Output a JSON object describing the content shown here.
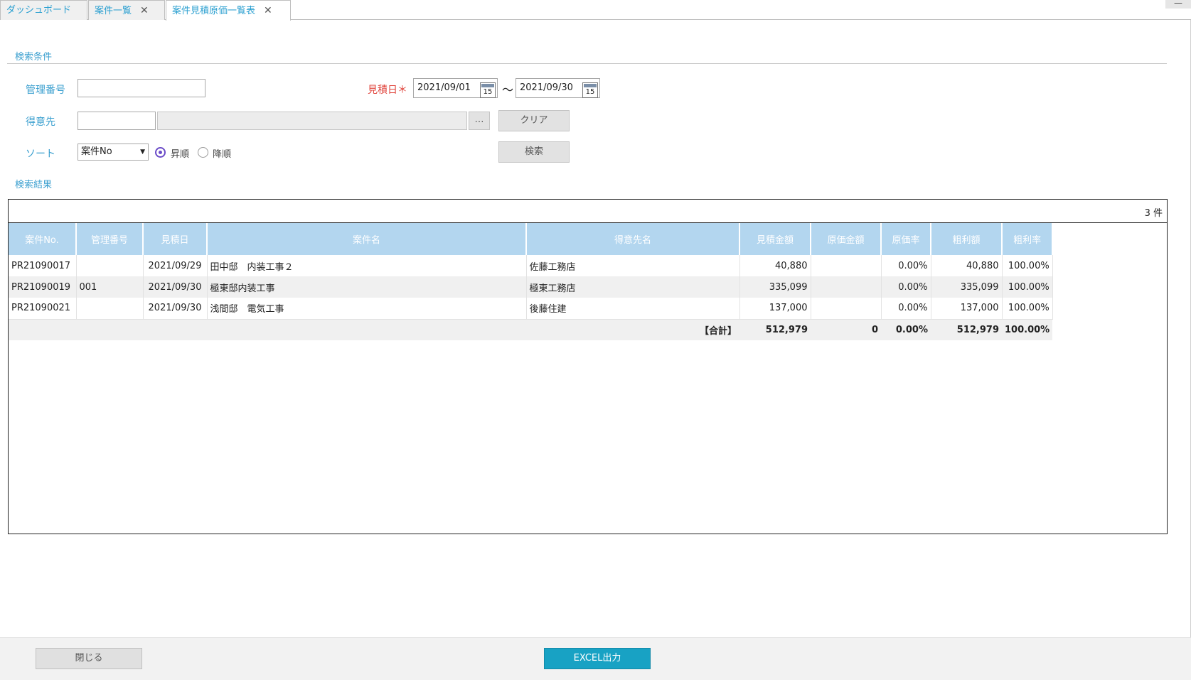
{
  "tabs": [
    {
      "label": "ダッシュボード",
      "closable": false
    },
    {
      "label": "案件一覧",
      "closable": true
    },
    {
      "label": "案件見積原価一覧表",
      "closable": true,
      "active": true
    }
  ],
  "window": {
    "minimize_label": "—"
  },
  "search": {
    "section_title": "検索条件",
    "mgmt_no_label": "管理番号",
    "mgmt_no_value": "",
    "estimate_date_label": "見積日＊",
    "date_from": "2021/09/01",
    "date_to": "2021/09/30",
    "date_sep": "〜",
    "calendar_icon_text": "15",
    "customer_label": "得意先",
    "customer_code": "",
    "customer_name": "",
    "lookup_label": "…",
    "clear_label": "クリア",
    "sort_label": "ソート",
    "sort_value": "案件No",
    "sort_asc_label": "昇順",
    "sort_desc_label": "降順",
    "sort_order": "asc",
    "search_label": "検索"
  },
  "results": {
    "section_title": "検索結果",
    "count_text": "3 件",
    "columns": [
      "案件No.",
      "管理番号",
      "見積日",
      "案件名",
      "得意先名",
      "見積金額",
      "原価金額",
      "原価率",
      "粗利額",
      "粗利率"
    ],
    "rows": [
      [
        "PR21090017",
        "",
        "2021/09/29",
        "田中邸　内装工事２",
        "佐藤工務店",
        "40,880",
        "",
        "0.00%",
        "40,880",
        "100.00%"
      ],
      [
        "PR21090019",
        "001",
        "2021/09/30",
        "極東邸内装工事",
        "極東工務店",
        "335,099",
        "",
        "0.00%",
        "335,099",
        "100.00%"
      ],
      [
        "PR21090021",
        "",
        "2021/09/30",
        "浅間邸　電気工事",
        "後藤住建",
        "137,000",
        "",
        "0.00%",
        "137,000",
        "100.00%"
      ]
    ],
    "total": {
      "label": "【合計】",
      "estimate": "512,979",
      "cost": "0",
      "cost_rate": "0.00%",
      "profit": "512,979",
      "profit_rate": "100.00%"
    }
  },
  "footer": {
    "close_label": "閉じる",
    "excel_label": "EXCEL出力"
  },
  "colors": {
    "accent": "#3a9fcf",
    "header_bg": "#b3d6ef",
    "excel_button": "#18a2c4",
    "required": "#e0443c",
    "radio": "#6b4cc8"
  }
}
